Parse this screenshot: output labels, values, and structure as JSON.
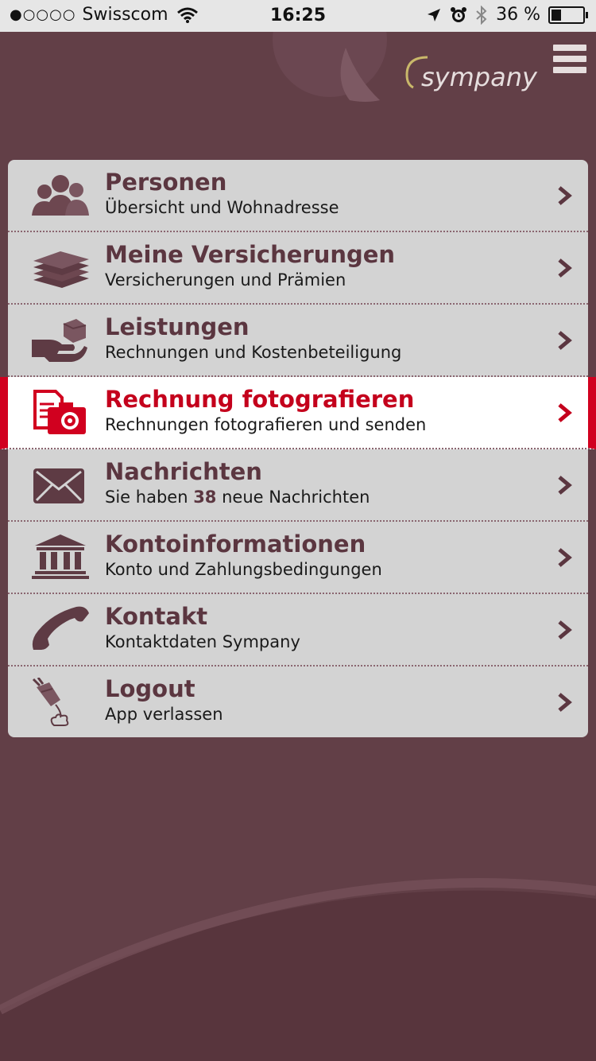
{
  "status_bar": {
    "signal_dots": "●○○○○",
    "carrier": "Swisscom",
    "time": "16:25",
    "battery_text": "36 %"
  },
  "header": {
    "logo_text": "sympany",
    "menu_icon": "hamburger-icon"
  },
  "menu": {
    "items": [
      {
        "title": "Personen",
        "subtitle": "Übersicht und Wohnadresse",
        "icon": "people-icon"
      },
      {
        "title": "Meine Versicherungen",
        "subtitle": "Versicherungen und Prämien",
        "icon": "stack-icon"
      },
      {
        "title": "Leistungen",
        "subtitle": "Rechnungen und Kostenbeteiligung",
        "icon": "hand-box-icon"
      },
      {
        "title": "Rechnung fotografieren",
        "subtitle": "Rechnungen fotografieren und senden",
        "icon": "camera-document-icon",
        "active": true
      },
      {
        "title": "Nachrichten",
        "subtitle_prefix": "Sie haben ",
        "subtitle_count": "38",
        "subtitle_suffix": " neue Nachrichten",
        "icon": "envelope-icon"
      },
      {
        "title": "Kontoinformationen",
        "subtitle": "Konto und Zahlungsbedingungen",
        "icon": "bank-icon"
      },
      {
        "title": "Kontakt",
        "subtitle": "Kontaktdaten Sympany",
        "icon": "phone-icon"
      },
      {
        "title": "Logout",
        "subtitle": "App verlassen",
        "icon": "plug-icon"
      }
    ]
  },
  "colors": {
    "background": "#623f47",
    "menu_bg": "#d3d3d3",
    "accent_red": "#c4001c",
    "title_color": "#5b3640"
  }
}
